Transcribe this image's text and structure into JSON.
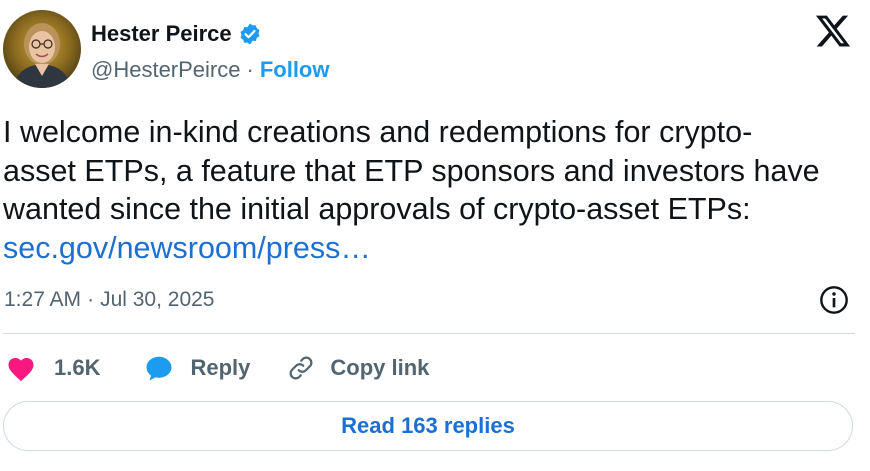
{
  "author": {
    "display_name": "Hester Peirce",
    "handle": "@HesterPeirce",
    "separator": "·",
    "follow_label": "Follow",
    "verified": true
  },
  "icons": {
    "brand": "x-logo-icon",
    "verified": "verified-badge-icon",
    "info": "info-icon",
    "like": "heart-icon",
    "reply": "speech-bubble-icon",
    "copy_link": "link-icon"
  },
  "tweet": {
    "lines": [
      "I welcome in-kind creations and redemptions for crypto-",
      "asset ETPs, a feature that ETP sponsors and investors have",
      "wanted since the initial approvals of crypto-asset ETPs:"
    ],
    "link_text": "sec.gov/newsroom/press…"
  },
  "timestamp": {
    "time": "1:27 AM",
    "separator": "·",
    "date": "Jul 30, 2025"
  },
  "actions": {
    "like_count": "1.6K",
    "reply_label": "Reply",
    "copy_link_label": "Copy link"
  },
  "read_replies_label": "Read 163 replies",
  "colors": {
    "accent": "#1d9bf0",
    "link": "#1d6fd1",
    "heart": "#f91880",
    "muted_text": "#536471",
    "text": "#0f1419",
    "border": "#cfd9de"
  }
}
